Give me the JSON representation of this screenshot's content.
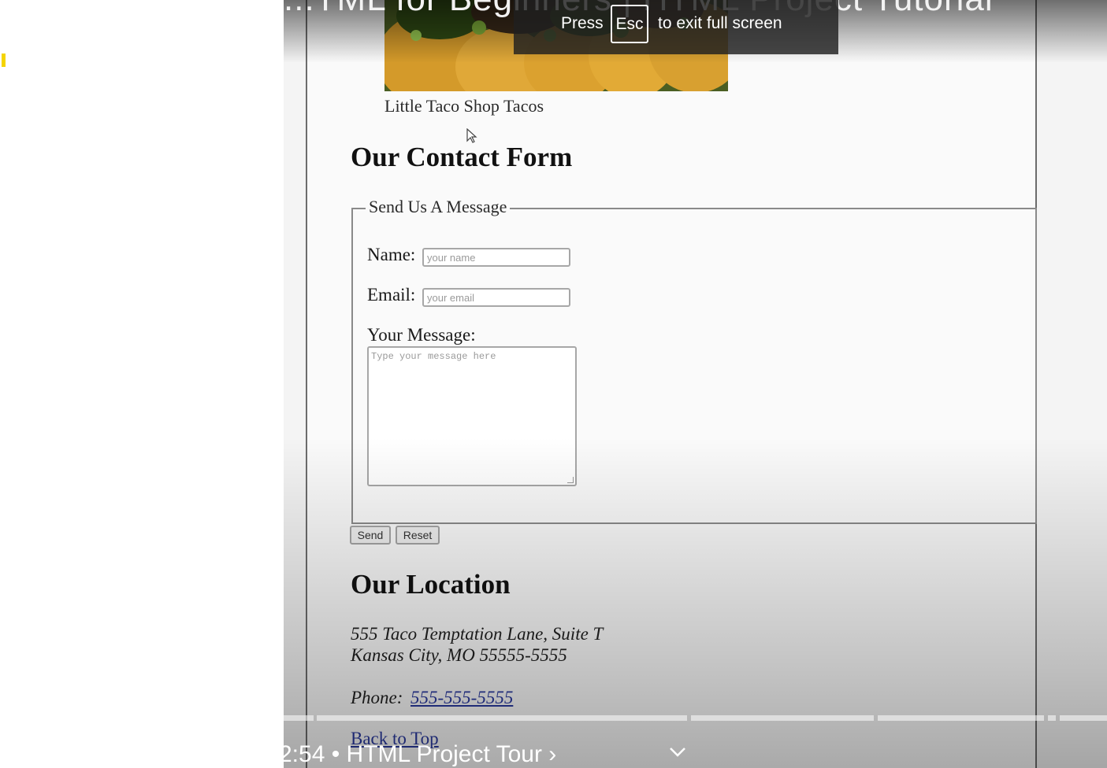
{
  "video": {
    "title": "...TML for Beginners | HTML Project Tutorial",
    "fullscreen_notice": {
      "press": "Press",
      "key": "Esc",
      "rest": "to exit full screen"
    },
    "chapter": "2:54 • HTML Project Tour ›",
    "icons": {
      "chapters_toggle": "chevron-down-icon",
      "pointer": "mouse-cursor-icon"
    }
  },
  "webpage": {
    "image_caption": "Little Taco Shop Tacos",
    "contact": {
      "heading": "Our Contact Form",
      "legend": "Send Us A Message",
      "name_label": "Name:",
      "name_placeholder": "your name",
      "email_label": "Email:",
      "email_placeholder": "your email",
      "message_label": "Your Message:",
      "message_placeholder": "Type your message here",
      "send_label": "Send",
      "reset_label": "Reset"
    },
    "location": {
      "heading": "Our Location",
      "address_line1": "555 Taco Temptation Lane, Suite T",
      "address_line2": "Kansas City, MO 55555-5555",
      "phone_label": "Phone:",
      "phone_number": "555-555-5555",
      "back_to_top": "Back to Top"
    }
  },
  "colors": {
    "link": "#2a3aa0",
    "marker": "#f5d400"
  }
}
